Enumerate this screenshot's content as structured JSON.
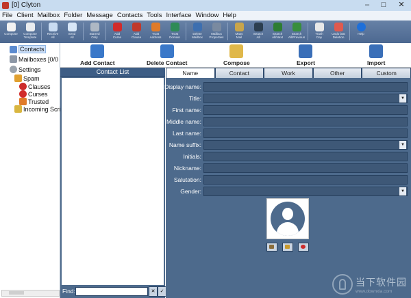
{
  "window": {
    "title": "[0] Clyton",
    "min": "–",
    "max": "□",
    "close": "✕"
  },
  "menu": [
    "File",
    "Client",
    "Mailbox",
    "Folder",
    "Message",
    "Contacts",
    "Tools",
    "Interface",
    "Window",
    "Help"
  ],
  "toolbar": [
    {
      "label": "Compose",
      "color": "#f2f2f2"
    },
    {
      "label": "Compose\nTemplate",
      "color": "#e9ecef"
    },
    {
      "label": "Receive\nAll",
      "color": "#c9dcf2"
    },
    {
      "label": "Send\nAll",
      "color": "#d7e6f7"
    },
    {
      "label": "Starred\nOnly",
      "color": "#aeb8c4"
    },
    {
      "label": "Add\nCurse",
      "color": "#d12b2b"
    },
    {
      "label": "Add\nClause",
      "color": "#c0392b"
    },
    {
      "label": "Trust\nAddress",
      "color": "#e07b2a"
    },
    {
      "label": "Trust\nDomain",
      "color": "#2e8b57"
    },
    {
      "label": "Delete\nMailbox",
      "color": "#3d6fb0"
    },
    {
      "label": "Mailbox\nProperties",
      "color": "#7a8aa0"
    },
    {
      "label": "Mass\nMail",
      "color": "#c9a54a"
    },
    {
      "label": "Search\nAll",
      "color": "#2c3e50"
    },
    {
      "label": "Search\nAll/Next",
      "color": "#2e7d32"
    },
    {
      "label": "Search\nAll/Previous",
      "color": "#388e3c"
    },
    {
      "label": "Trash\nDay",
      "color": "#e8e8e8"
    },
    {
      "label": "Undo last\nDeletion",
      "color": "#e05a4f"
    },
    {
      "label": "Help",
      "color": "#1e6fd9"
    }
  ],
  "tree": {
    "contacts": "Contacts",
    "mailboxes": "Mailboxes [0/0",
    "settings": "Settings",
    "spam": "Spam",
    "clauses": "Clauses",
    "curses": "Curses",
    "trusted": "Trusted",
    "incoming": "Incoming Scrip"
  },
  "actions": [
    {
      "label": "Add Contact",
      "color": "#3a78c9"
    },
    {
      "label": "Delete Contact",
      "color": "#3a78c9"
    },
    {
      "label": "Compose",
      "color": "#e0b84a"
    },
    {
      "label": "Export",
      "color": "#3a6fb8"
    },
    {
      "label": "Import",
      "color": "#3a6fb8"
    }
  ],
  "contact_list": {
    "header": "Contact List",
    "find_label": "Find:",
    "find_value": ""
  },
  "tabs": [
    {
      "label": "Name",
      "active": true
    },
    {
      "label": "Contact",
      "active": false
    },
    {
      "label": "Work",
      "active": false
    },
    {
      "label": "Other",
      "active": false
    },
    {
      "label": "Custom",
      "active": false
    }
  ],
  "fields": [
    {
      "label": "Display name:",
      "dropdown": false
    },
    {
      "label": "Title:",
      "dropdown": true
    },
    {
      "label": "First name:",
      "dropdown": false
    },
    {
      "label": "Middle name:",
      "dropdown": false
    },
    {
      "label": "Last name:",
      "dropdown": false
    },
    {
      "label": "Name suffix:",
      "dropdown": true
    },
    {
      "label": "Initials:",
      "dropdown": false
    },
    {
      "label": "Nickname:",
      "dropdown": false
    },
    {
      "label": "Salutation:",
      "dropdown": false
    },
    {
      "label": "Gender:",
      "dropdown": true
    }
  ],
  "watermark": {
    "main": "当下软件园",
    "sub": "www.downxia.com"
  }
}
